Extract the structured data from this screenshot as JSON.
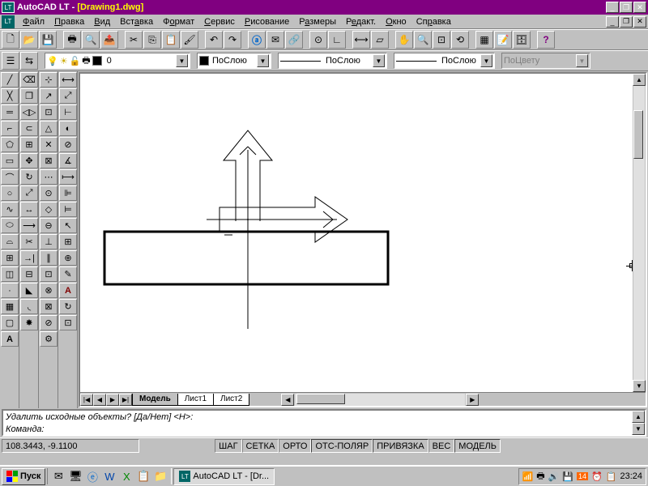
{
  "title": {
    "app": "AutoCAD LT - ",
    "doc": "[Drawing1.dwg]"
  },
  "menu": [
    "Файл",
    "Правка",
    "Вид",
    "Вставка",
    "Формат",
    "Сервис",
    "Рисование",
    "Размеры",
    "Редакт.",
    "Окно",
    "Справка"
  ],
  "layer": {
    "current": "0"
  },
  "combo": {
    "poSloyu1": "ПоСлою",
    "poSloyu2": "ПоСлою",
    "poSloyu3": "ПоСлою",
    "poTsvetu": "ПоЦвету"
  },
  "tabs": {
    "model": "Модель",
    "sheet1": "Лист1",
    "sheet2": "Лист2"
  },
  "cmd": {
    "line1": "Удалить исходные объекты? [Да/Нет] <Н>:",
    "line2": "Команда:"
  },
  "status": {
    "coords": "108.3443, -9.1100",
    "cells": [
      "ШАГ",
      "СЕТКА",
      "ОРТО",
      "ОТС-ПОЛЯР",
      "ПРИВЯЗКА",
      "ВЕС",
      "МОДЕЛЬ"
    ]
  },
  "taskbar": {
    "start": "Пуск",
    "task": "AutoCAD LT - [Dr...",
    "time": "23:24"
  }
}
